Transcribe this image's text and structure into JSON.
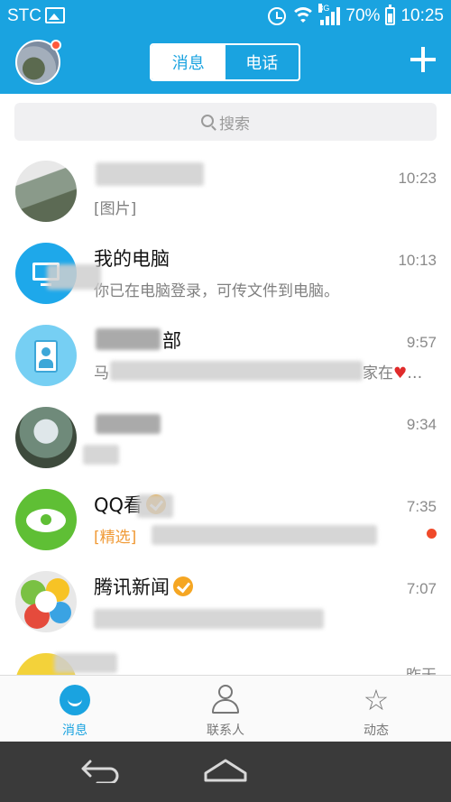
{
  "status_bar": {
    "carrier": "STC",
    "network": "3G",
    "battery": "70%",
    "time": "10:25"
  },
  "header": {
    "tabs": [
      {
        "label": "消息",
        "active": true
      },
      {
        "label": "电话",
        "active": false
      }
    ]
  },
  "search": {
    "placeholder": "搜索"
  },
  "conversations": [
    {
      "name": "",
      "message": "[图片]",
      "time": "10:23"
    },
    {
      "name": "我的电脑",
      "message": "你已在电脑登录，可传文件到电脑。",
      "time": "10:13"
    },
    {
      "name": "部",
      "message": "马",
      "message_tail": "家在",
      "time": "9:57"
    },
    {
      "name": "",
      "message": "",
      "time": "9:34"
    },
    {
      "name": "QQ看",
      "message_tag": "[精选]",
      "message": "",
      "time": "7:35",
      "unread_dot": true
    },
    {
      "name": "腾讯新闻",
      "message": "",
      "time": "7:07"
    },
    {
      "name": "",
      "message": "",
      "time": "昨天"
    }
  ],
  "bottom_nav": [
    {
      "label": "消息",
      "icon": "message-icon",
      "active": true
    },
    {
      "label": "联系人",
      "icon": "contacts-icon",
      "active": false
    },
    {
      "label": "动态",
      "icon": "star-icon",
      "active": false
    }
  ],
  "colors": {
    "brand": "#1aa3e0",
    "unread": "#f04a2a",
    "tag": "#f09a36"
  }
}
